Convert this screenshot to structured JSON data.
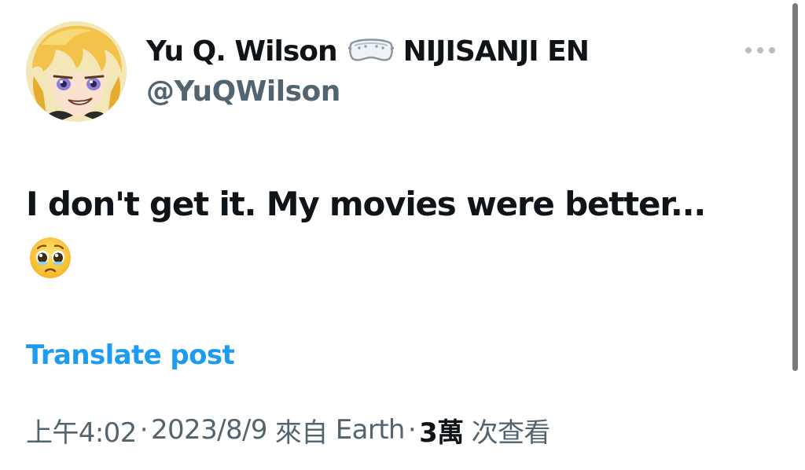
{
  "post": {
    "author": {
      "display_name": "Yu Q. Wilson",
      "badge_icon": "lab-goggles-icon",
      "affiliation": "NIJISANJI EN",
      "handle": "@YuQWilson"
    },
    "more_icon": "more-horizontal-icon",
    "text": "I don't get it. My movies were better...",
    "emoji": "pleading-face-emoji",
    "translate_label": "Translate post",
    "meta": {
      "time": "上午4:02",
      "separator": "·",
      "date": "2023/8/9",
      "from_prefix": "來自",
      "location": "Earth",
      "views_count": "3萬",
      "views_label": "次查看"
    }
  },
  "colors": {
    "text_primary": "#0f1419",
    "text_secondary": "#536471",
    "link": "#1d9bf0",
    "more_dots": "#b3bfc9"
  }
}
